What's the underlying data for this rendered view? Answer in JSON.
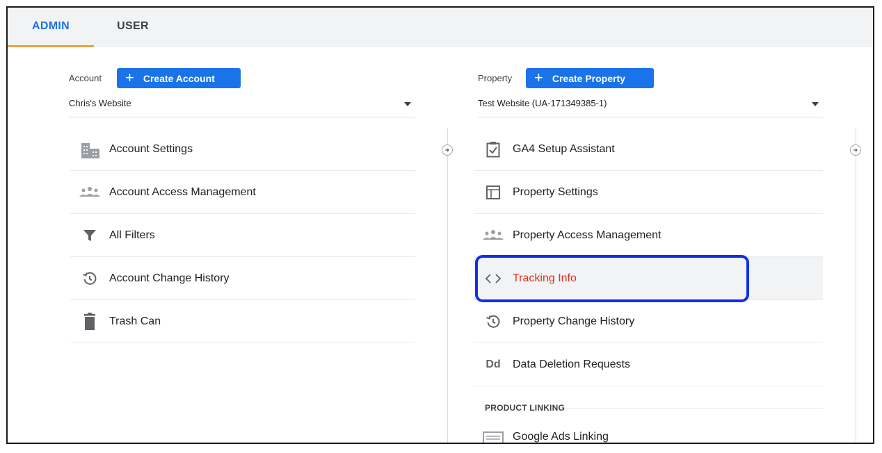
{
  "tabs": {
    "admin": "ADMIN",
    "user": "USER"
  },
  "account": {
    "label": "Account",
    "create_label": "Create Account",
    "selected": "Chris's Website",
    "items": [
      {
        "label": "Account Settings",
        "icon": "building-icon"
      },
      {
        "label": "Account Access Management",
        "icon": "people-icon"
      },
      {
        "label": "All Filters",
        "icon": "filter-icon"
      },
      {
        "label": "Account Change History",
        "icon": "history-icon"
      },
      {
        "label": "Trash Can",
        "icon": "trash-icon"
      }
    ]
  },
  "property": {
    "label": "Property",
    "create_label": "Create Property",
    "selected": "Test Website (UA-171349385-1)",
    "items": [
      {
        "label": "GA4 Setup Assistant",
        "icon": "checklist-icon"
      },
      {
        "label": "Property Settings",
        "icon": "layout-icon"
      },
      {
        "label": "Property Access Management",
        "icon": "people-icon"
      },
      {
        "label": "Tracking Info",
        "icon": "code-icon",
        "selected": true
      },
      {
        "label": "Property Change History",
        "icon": "history-icon"
      },
      {
        "label": "Data Deletion Requests",
        "icon": "dd-icon",
        "icon_text": "Dd"
      }
    ],
    "section_product_linking": "PRODUCT LINKING",
    "linking_items": [
      {
        "label": "Google Ads Linking",
        "icon": "ads-linking-icon"
      }
    ]
  },
  "colors": {
    "accent": "#1a73e8",
    "tab_underline": "#e8a33d",
    "selected_text": "#d93025",
    "highlight_border": "#1030e8"
  }
}
